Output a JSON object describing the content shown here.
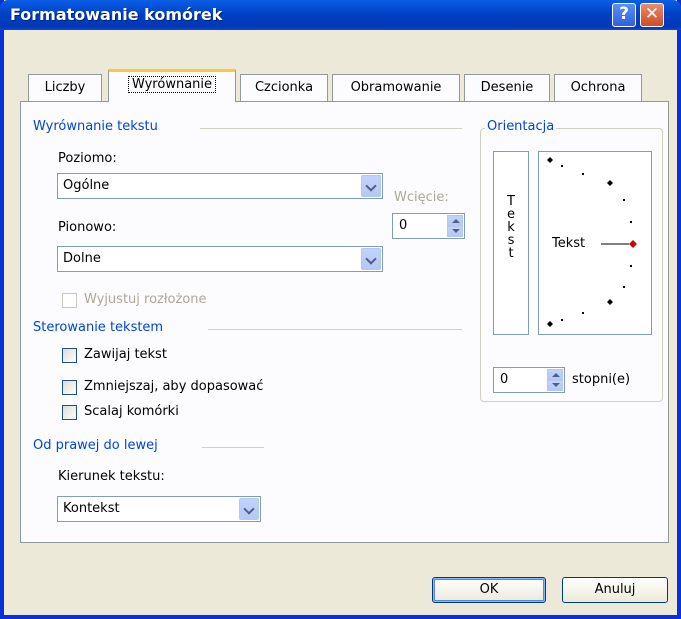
{
  "window": {
    "title": "Formatowanie komórek",
    "help": "?",
    "close": "✕"
  },
  "tabs": [
    "Liczby",
    "Wyrównanie",
    "Czcionka",
    "Obramowanie",
    "Desenie",
    "Ochrona"
  ],
  "alignment": {
    "group": "Wyrównanie tekstu",
    "horizontal_label": "Poziomo:",
    "horizontal_value": "Ogólne",
    "indent_label": "Wcięcie:",
    "indent_value": "0",
    "vertical_label": "Pionowo:",
    "vertical_value": "Dolne",
    "justify_distributed": "Wyjustuj rozłożone"
  },
  "text_control": {
    "group": "Sterowanie tekstem",
    "wrap": "Zawijaj tekst",
    "shrink": "Zmniejszaj, aby dopasować",
    "merge": "Scalaj komórki"
  },
  "rtl": {
    "group": "Od prawej do lewej",
    "direction_label": "Kierunek tekstu:",
    "direction_value": "Kontekst"
  },
  "orientation": {
    "group": "Orientacja",
    "vertical_letters": [
      "T",
      "e",
      "k",
      "s",
      "t"
    ],
    "dial_text": "Tekst",
    "degrees_value": "0",
    "degrees_label": "stopni(e)"
  },
  "buttons": {
    "ok": "OK",
    "cancel": "Anuluj"
  },
  "colors": {
    "group_text": "#0046d5",
    "titlebar": "#0041c6",
    "dial_marker": "#d00000"
  }
}
